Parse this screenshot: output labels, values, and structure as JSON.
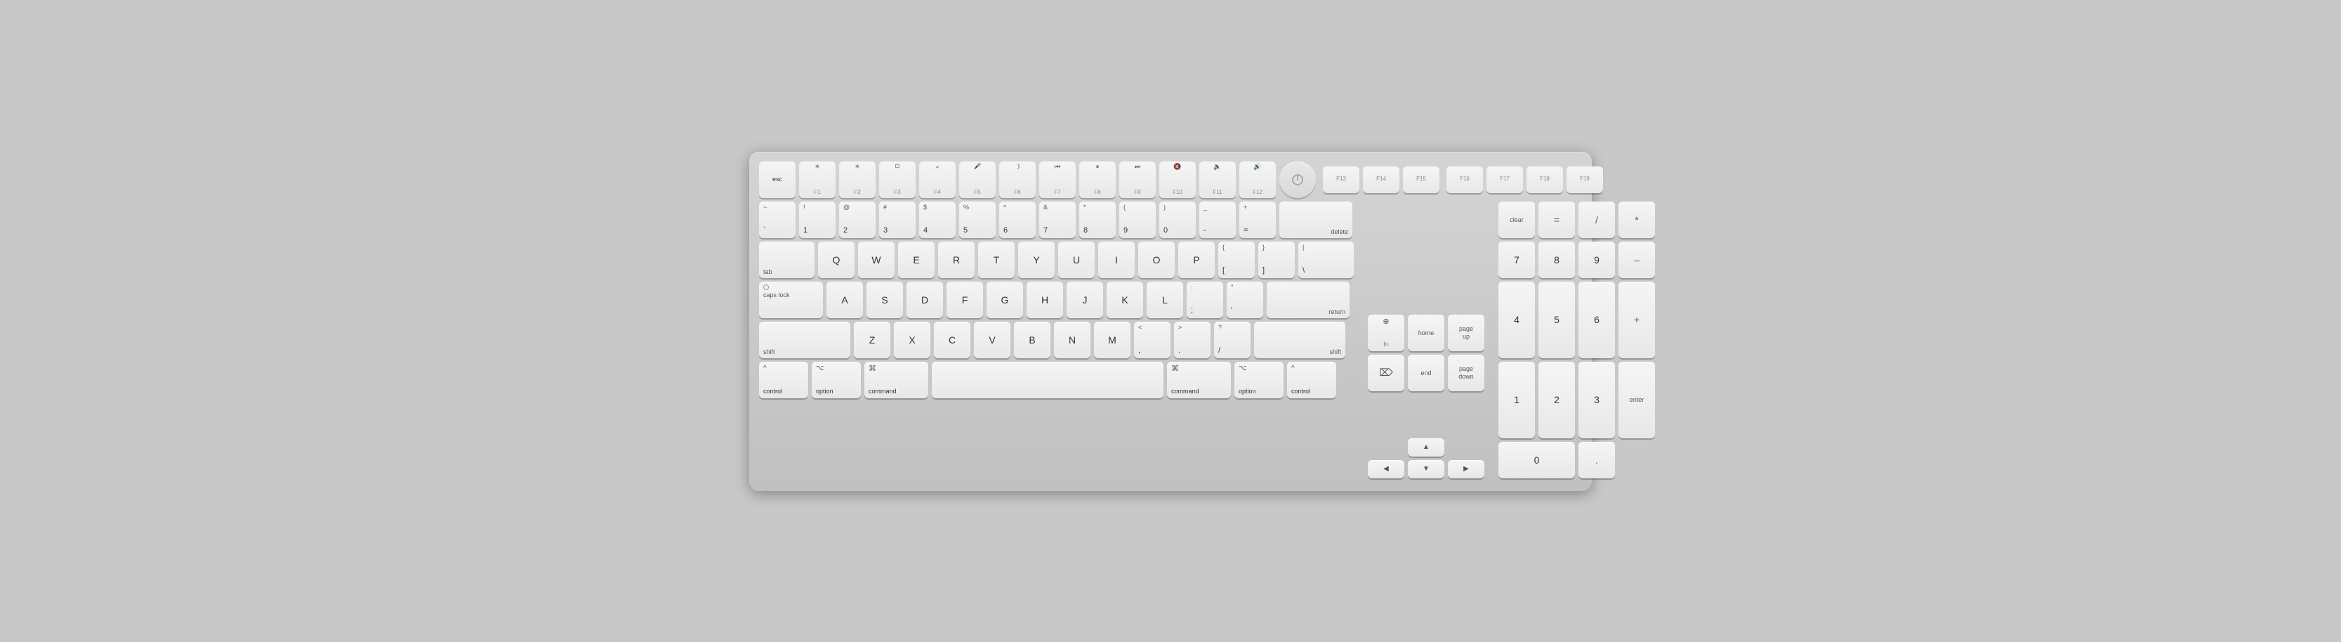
{
  "keyboard": {
    "fn_row": [
      {
        "id": "esc",
        "top": "",
        "bottom": "esc",
        "width": "w1"
      },
      {
        "id": "f1",
        "top": "☀",
        "bottom": "F1",
        "width": "w1"
      },
      {
        "id": "f2",
        "top": "☀",
        "bottom": "F2",
        "width": "w1"
      },
      {
        "id": "f3",
        "top": "⊞",
        "bottom": "F3",
        "width": "w1"
      },
      {
        "id": "f4",
        "top": "⌕",
        "bottom": "F4",
        "width": "w1"
      },
      {
        "id": "f5",
        "top": "⏺",
        "bottom": "F5",
        "width": "w1"
      },
      {
        "id": "f6",
        "top": "☽",
        "bottom": "F6",
        "width": "w1"
      },
      {
        "id": "f7",
        "top": "◀◀",
        "bottom": "F7",
        "width": "w1"
      },
      {
        "id": "f8",
        "top": "▶‖",
        "bottom": "F8",
        "width": "w1"
      },
      {
        "id": "f9",
        "top": "▶▶",
        "bottom": "F9",
        "width": "w1"
      },
      {
        "id": "f10",
        "top": "◁",
        "bottom": "F10",
        "width": "w1"
      },
      {
        "id": "f11",
        "top": "◁)",
        "bottom": "F11",
        "width": "w1"
      },
      {
        "id": "f12",
        "top": "◁)))",
        "bottom": "F12",
        "width": "w1"
      },
      {
        "id": "power",
        "type": "power"
      },
      {
        "id": "f13",
        "top": "",
        "bottom": "F13",
        "width": "w1"
      },
      {
        "id": "f14",
        "top": "",
        "bottom": "F14",
        "width": "w1"
      },
      {
        "id": "f15",
        "top": "",
        "bottom": "F15",
        "width": "w1"
      },
      {
        "id": "f16",
        "top": "",
        "bottom": "F16",
        "width": "w1"
      },
      {
        "id": "f17",
        "top": "",
        "bottom": "F17",
        "width": "w1"
      },
      {
        "id": "f18",
        "top": "",
        "bottom": "F18",
        "width": "w1"
      },
      {
        "id": "f19",
        "top": "",
        "bottom": "F19",
        "width": "w1"
      }
    ],
    "row1": [
      {
        "top": "~",
        "bottom": "`",
        "id": "grave"
      },
      {
        "top": "!",
        "bottom": "1",
        "id": "1"
      },
      {
        "top": "@",
        "bottom": "2",
        "id": "2"
      },
      {
        "top": "#",
        "bottom": "3",
        "id": "3"
      },
      {
        "top": "$",
        "bottom": "4",
        "id": "4"
      },
      {
        "top": "%",
        "bottom": "5",
        "id": "5"
      },
      {
        "top": "^",
        "bottom": "6",
        "id": "6"
      },
      {
        "top": "&",
        "bottom": "7",
        "id": "7"
      },
      {
        "top": "*",
        "bottom": "8",
        "id": "8"
      },
      {
        "top": "(",
        "bottom": "9",
        "id": "9"
      },
      {
        "top": ")",
        "bottom": "0",
        "id": "0"
      },
      {
        "top": "_",
        "bottom": "-",
        "id": "minus"
      },
      {
        "top": "+",
        "bottom": "=",
        "id": "equals"
      },
      {
        "top": "",
        "bottom": "delete",
        "id": "delete",
        "width": "w2"
      }
    ],
    "row2": [
      {
        "top": "",
        "bottom": "tab",
        "id": "tab",
        "width": "w1h"
      },
      {
        "top": "",
        "bottom": "Q",
        "id": "q"
      },
      {
        "top": "",
        "bottom": "W",
        "id": "w"
      },
      {
        "top": "",
        "bottom": "E",
        "id": "e"
      },
      {
        "top": "",
        "bottom": "R",
        "id": "r"
      },
      {
        "top": "",
        "bottom": "T",
        "id": "t"
      },
      {
        "top": "",
        "bottom": "Y",
        "id": "y"
      },
      {
        "top": "",
        "bottom": "U",
        "id": "u"
      },
      {
        "top": "",
        "bottom": "I",
        "id": "i"
      },
      {
        "top": "",
        "bottom": "O",
        "id": "o"
      },
      {
        "top": "",
        "bottom": "P",
        "id": "p"
      },
      {
        "top": "{",
        "bottom": "[",
        "id": "lbracket"
      },
      {
        "top": "}",
        "bottom": "]",
        "id": "rbracket"
      },
      {
        "top": "|",
        "bottom": "\\",
        "id": "backslash",
        "width": "w1h"
      }
    ],
    "row3": [
      {
        "top": "•",
        "bottom": "caps lock",
        "id": "capslock",
        "width": "w2"
      },
      {
        "top": "",
        "bottom": "A",
        "id": "a"
      },
      {
        "top": "",
        "bottom": "S",
        "id": "s"
      },
      {
        "top": "",
        "bottom": "D",
        "id": "d"
      },
      {
        "top": "",
        "bottom": "F",
        "id": "f"
      },
      {
        "top": "",
        "bottom": "G",
        "id": "g"
      },
      {
        "top": "",
        "bottom": "H",
        "id": "h"
      },
      {
        "top": "",
        "bottom": "J",
        "id": "j"
      },
      {
        "top": "",
        "bottom": "K",
        "id": "k"
      },
      {
        "top": "",
        "bottom": "L",
        "id": "l"
      },
      {
        "top": ":",
        "bottom": ";",
        "id": "semicolon"
      },
      {
        "top": "\"",
        "bottom": "'",
        "id": "quote"
      },
      {
        "top": "",
        "bottom": "return",
        "id": "return",
        "width": "w2h"
      }
    ],
    "row4": [
      {
        "top": "",
        "bottom": "shift",
        "id": "lshift",
        "width": "w3"
      },
      {
        "top": "",
        "bottom": "Z",
        "id": "z"
      },
      {
        "top": "",
        "bottom": "X",
        "id": "x"
      },
      {
        "top": "",
        "bottom": "C",
        "id": "c"
      },
      {
        "top": "",
        "bottom": "V",
        "id": "v"
      },
      {
        "top": "",
        "bottom": "B",
        "id": "b"
      },
      {
        "top": "",
        "bottom": "N",
        "id": "n"
      },
      {
        "top": "",
        "bottom": "M",
        "id": "m"
      },
      {
        "top": "<",
        "bottom": ",",
        "id": "comma"
      },
      {
        "top": ">",
        "bottom": ".",
        "id": "period"
      },
      {
        "top": "?",
        "bottom": "/",
        "id": "slash"
      },
      {
        "top": "",
        "bottom": "shift",
        "id": "rshift",
        "width": "w3"
      }
    ],
    "row5": [
      {
        "top": "^",
        "bottom": "control",
        "id": "lcontrol",
        "width": "w1h"
      },
      {
        "top": "⌥",
        "bottom": "option",
        "id": "loption",
        "width": "w1h"
      },
      {
        "top": "⌘",
        "bottom": "command",
        "id": "lcommand",
        "width": "w2"
      },
      {
        "top": "",
        "bottom": "",
        "id": "space",
        "width": "wspace"
      },
      {
        "top": "⌘",
        "bottom": "command",
        "id": "rcommand",
        "width": "w2"
      },
      {
        "top": "⌥",
        "bottom": "option",
        "id": "roption",
        "width": "w1h"
      },
      {
        "top": "^",
        "bottom": "control",
        "id": "rcontrol",
        "width": "w1h"
      }
    ],
    "nav_cluster": [
      {
        "id": "fn_globe",
        "top": "⊕",
        "bottom": "fn",
        "width": "w1"
      },
      {
        "id": "home",
        "top": "",
        "bottom": "home",
        "width": "w1"
      },
      {
        "id": "page_up",
        "top": "page",
        "bottom": "up",
        "width": "w1"
      }
    ],
    "nav_cluster2": [
      {
        "id": "fwd_del",
        "top": "⌦",
        "bottom": "",
        "width": "w1"
      },
      {
        "id": "end",
        "top": "",
        "bottom": "end",
        "width": "w1"
      },
      {
        "id": "page_down",
        "top": "page",
        "bottom": "down",
        "width": "w1"
      }
    ],
    "arrows": [
      {
        "id": "arrow_up",
        "char": "▲"
      },
      {
        "id": "arrow_left",
        "char": "◀"
      },
      {
        "id": "arrow_down",
        "char": "▼"
      },
      {
        "id": "arrow_right",
        "char": "▶"
      }
    ],
    "numpad": {
      "clear": "clear",
      "equals": "=",
      "divide": "/",
      "multiply": "*",
      "n7": "7",
      "n8": "8",
      "n9": "9",
      "minus": "–",
      "n4": "4",
      "n5": "5",
      "n6": "6",
      "plus": "+",
      "n1": "1",
      "n2": "2",
      "n3": "3",
      "n0": "0",
      "decimal": ".",
      "enter": "enter"
    }
  }
}
